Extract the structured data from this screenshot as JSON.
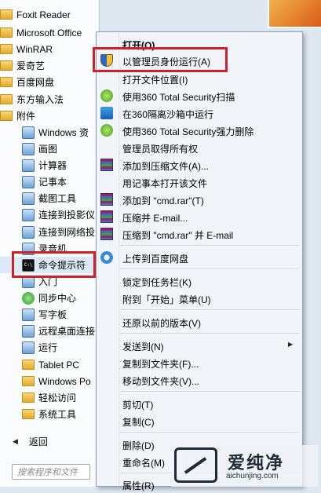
{
  "start_menu": {
    "items": [
      {
        "label": "Foxit Reader",
        "icon": "folder-icon",
        "type": "folder"
      },
      {
        "label": "Microsoft Office",
        "icon": "folder-icon",
        "type": "folder"
      },
      {
        "label": "WinRAR",
        "icon": "folder-icon",
        "type": "folder"
      },
      {
        "label": "爱奇艺",
        "icon": "folder-icon",
        "type": "folder"
      },
      {
        "label": "百度网盘",
        "icon": "folder-icon",
        "type": "folder"
      },
      {
        "label": "东方输入法",
        "icon": "folder-icon",
        "type": "folder"
      },
      {
        "label": "附件",
        "icon": "folder-icon",
        "type": "folder"
      },
      {
        "label": "Windows 资",
        "icon": "explorer-icon",
        "type": "app"
      },
      {
        "label": "画图",
        "icon": "paint-icon",
        "type": "app"
      },
      {
        "label": "计算器",
        "icon": "calculator-icon",
        "type": "app"
      },
      {
        "label": "记事本",
        "icon": "notepad-icon",
        "type": "app"
      },
      {
        "label": "截图工具",
        "icon": "snipping-icon",
        "type": "app"
      },
      {
        "label": "连接到投影仪",
        "icon": "projector-icon",
        "type": "app"
      },
      {
        "label": "连接到网络投",
        "icon": "network-projector-icon",
        "type": "app"
      },
      {
        "label": "录音机",
        "icon": "recorder-icon",
        "type": "app"
      },
      {
        "label": "命令提示符",
        "icon": "cmd-icon",
        "type": "cmd"
      },
      {
        "label": "入门",
        "icon": "getting-started-icon",
        "type": "app"
      },
      {
        "label": "同步中心",
        "icon": "sync-icon",
        "type": "green"
      },
      {
        "label": "写字板",
        "icon": "wordpad-icon",
        "type": "app"
      },
      {
        "label": "远程桌面连接",
        "icon": "remote-desktop-icon",
        "type": "app"
      },
      {
        "label": "运行",
        "icon": "run-icon",
        "type": "app"
      },
      {
        "label": "Tablet PC",
        "icon": "folder-icon",
        "type": "folder"
      },
      {
        "label": "Windows Po",
        "icon": "folder-icon",
        "type": "folder"
      },
      {
        "label": "轻松访问",
        "icon": "folder-icon",
        "type": "folder"
      },
      {
        "label": "系统工具",
        "icon": "folder-icon",
        "type": "folder"
      }
    ],
    "back_label": "返回",
    "search_placeholder": "搜索程序和文件"
  },
  "context_menu": {
    "items": [
      {
        "label": "打开(O)",
        "icon": "",
        "bold": true
      },
      {
        "label": "以管理员身份运行(A)",
        "icon": "uac-shield-icon"
      },
      {
        "label": "打开文件位置(I)",
        "icon": ""
      },
      {
        "label": "使用360 Total Security扫描",
        "icon": "360-icon"
      },
      {
        "label": "在360隔离沙箱中运行",
        "icon": "360-sandbox-icon"
      },
      {
        "label": "使用360 Total Security强力删除",
        "icon": "360-icon"
      },
      {
        "label": "管理员取得所有权",
        "icon": ""
      },
      {
        "label": "添加到压缩文件(A)...",
        "icon": "winrar-icon"
      },
      {
        "label": "用记事本打开该文件",
        "icon": ""
      },
      {
        "label": "添加到 \"cmd.rar\"(T)",
        "icon": "winrar-icon"
      },
      {
        "label": "压缩并 E-mail...",
        "icon": "winrar-icon"
      },
      {
        "label": "压缩到 \"cmd.rar\" 并 E-mail",
        "icon": "winrar-icon"
      },
      {
        "label": "上传到百度网盘",
        "icon": "baidu-cloud-icon"
      },
      {
        "label": "锁定到任务栏(K)",
        "icon": ""
      },
      {
        "label": "附到「开始」菜单(U)",
        "icon": ""
      },
      {
        "label": "还原以前的版本(V)",
        "icon": ""
      },
      {
        "label": "发送到(N)",
        "icon": "",
        "submenu": true
      },
      {
        "label": "复制到文件夹(F)...",
        "icon": ""
      },
      {
        "label": "移动到文件夹(V)...",
        "icon": ""
      },
      {
        "label": "剪切(T)",
        "icon": ""
      },
      {
        "label": "复制(C)",
        "icon": ""
      },
      {
        "label": "删除(D)",
        "icon": ""
      },
      {
        "label": "重命名(M)",
        "icon": ""
      },
      {
        "label": "属性(R)",
        "icon": ""
      }
    ]
  },
  "watermark": {
    "title": "爱纯净",
    "url": "aichunjing.com"
  },
  "colors": {
    "highlight_border": "#d32027",
    "menu_bg": "#f1f4f9",
    "start_bg": "#fafbfd"
  }
}
